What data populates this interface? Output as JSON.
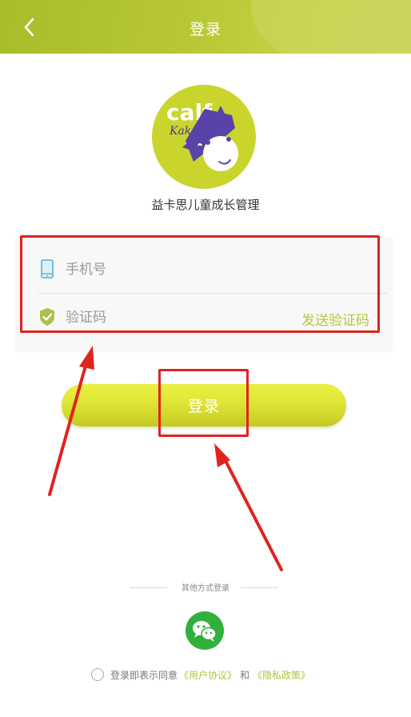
{
  "header": {
    "title": "登录"
  },
  "logo": {
    "brand_text_1": "calf",
    "brand_text_2": "Kaka"
  },
  "app_name": "益卡思儿童成长管理",
  "form": {
    "phone_placeholder": "手机号",
    "code_placeholder": "验证码",
    "send_code_label": "发送验证码"
  },
  "login_button": {
    "label": "登录"
  },
  "other_login": {
    "label": "其他方式登录",
    "options": [
      "wechat-icon"
    ]
  },
  "agreement": {
    "prefix": "登录即表示同意",
    "user_agreement": "《用户协议》",
    "and": "和",
    "privacy_policy": "《隐私政策》"
  },
  "colors": {
    "header": "#b7c734",
    "accent": "#b9c63d",
    "login_button": "#dfe536",
    "annotation_red": "#e0231f",
    "wechat": "#2fb13b"
  }
}
